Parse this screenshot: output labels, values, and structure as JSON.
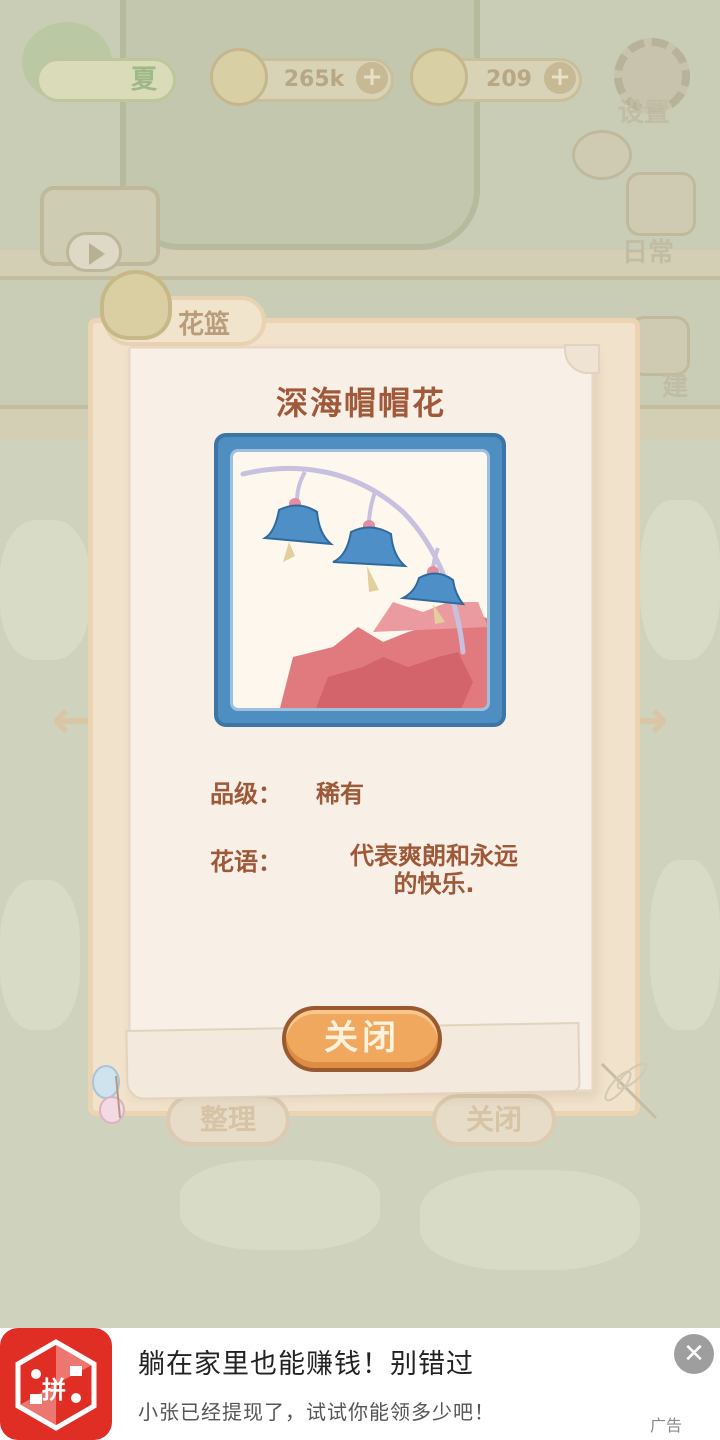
{
  "hud": {
    "season_label": "夏",
    "coins": "265k",
    "gems": "209",
    "plus": "+",
    "settings_label": "设置",
    "daily_label": "日常",
    "build_label": "建"
  },
  "basket": {
    "label": "花篮"
  },
  "flower_card": {
    "name": "深海帽帽花",
    "grade_label": "品级：",
    "grade_value": "稀有",
    "meaning_label": "花语：",
    "meaning_line1": "代表爽朗和永远",
    "meaning_line2": "的快乐.",
    "close_label": "关闭"
  },
  "nav": {
    "prev_arrow": "←",
    "next_arrow": "→"
  },
  "background_buttons": {
    "organize": "整理",
    "close": "关闭"
  },
  "ad": {
    "logo_text": "拼",
    "title": "躺在家里也能赚钱！别错过",
    "subtitle": "小张已经提现了，试试你能领多少吧！",
    "tag": "广告",
    "close": "✕"
  },
  "colors": {
    "modal_title": "#a05a3a",
    "frame_blue": "#4f8ec0",
    "close_button": "#f0a85f",
    "ad_logo": "#e02e24"
  }
}
